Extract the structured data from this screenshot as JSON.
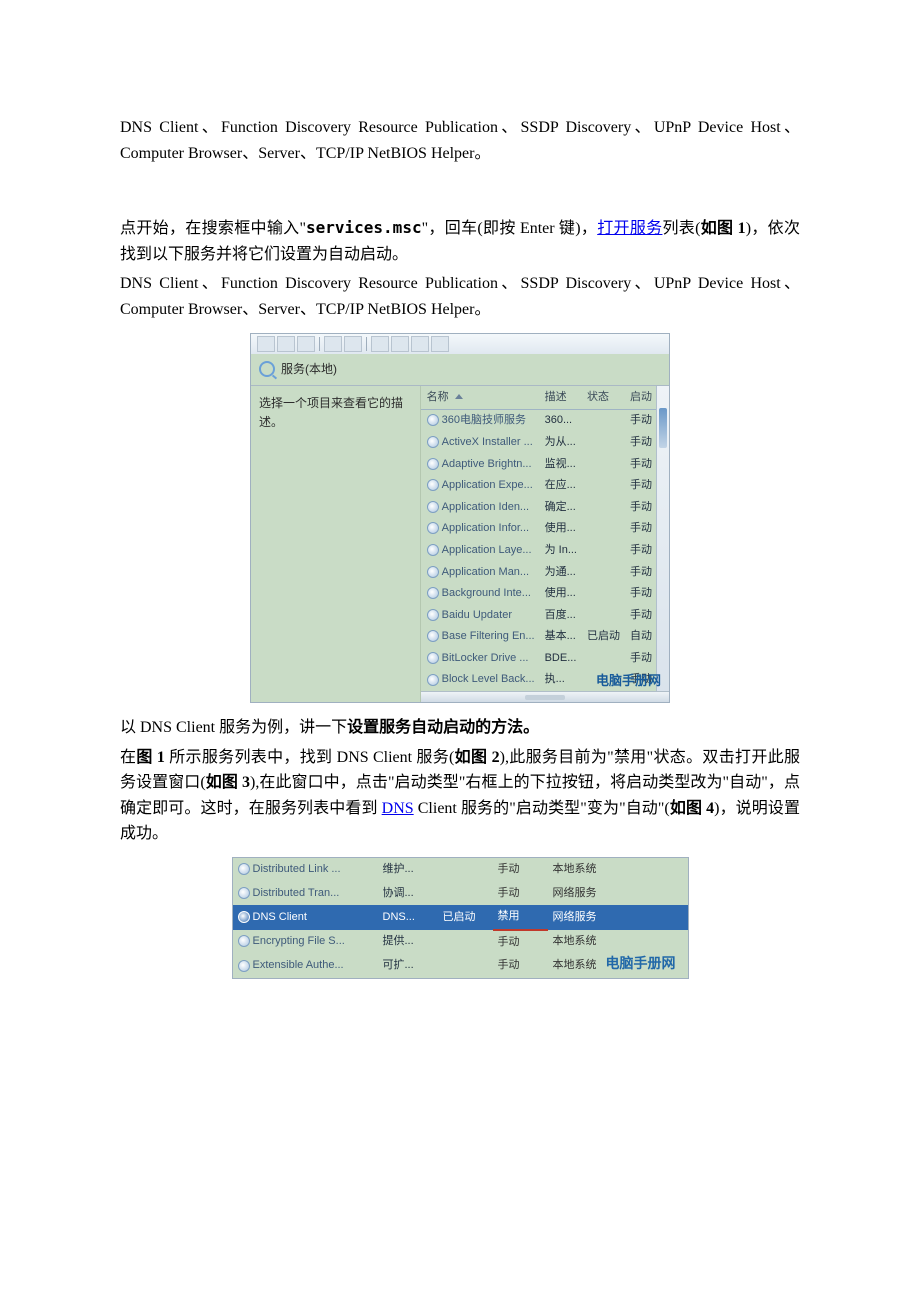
{
  "para1": "DNS Client、Function Discovery Resource Publication、SSDP Discovery、UPnP Device Host、Computer Browser、Server、TCP/IP NetBIOS Helper。",
  "para2a": "点开始，在搜索框中输入\"",
  "para2_cmd": "services.msc",
  "para2b": "\"，回车(即按 Enter 键)，",
  "para2_link": "打开服务",
  "para2c": "列表(",
  "para2_fig": "如图 1",
  "para2d": ")，依次找到以下服务并将它们设置为自动启动。",
  "para3": "DNS Client、Function Discovery Resource Publication、SSDP Discovery、UPnP Device Host、Computer Browser、Server、TCP/IP NetBIOS Helper。",
  "fig1": {
    "title": "服务(本地)",
    "left_hint": "选择一个项目来查看它的描述。",
    "columns": {
      "name": "名称",
      "desc": "描述",
      "state": "状态",
      "startup": "启动"
    },
    "rows": [
      {
        "name": "360电脑技师服务",
        "desc": "360...",
        "state": "",
        "startup": "手动"
      },
      {
        "name": "ActiveX Installer ...",
        "desc": "为从...",
        "state": "",
        "startup": "手动"
      },
      {
        "name": "Adaptive Brightn...",
        "desc": "监视...",
        "state": "",
        "startup": "手动"
      },
      {
        "name": "Application Expe...",
        "desc": "在应...",
        "state": "",
        "startup": "手动"
      },
      {
        "name": "Application Iden...",
        "desc": "确定...",
        "state": "",
        "startup": "手动"
      },
      {
        "name": "Application Infor...",
        "desc": "使用...",
        "state": "",
        "startup": "手动"
      },
      {
        "name": "Application Laye...",
        "desc": "为 In...",
        "state": "",
        "startup": "手动"
      },
      {
        "name": "Application Man...",
        "desc": "为通...",
        "state": "",
        "startup": "手动"
      },
      {
        "name": "Background Inte...",
        "desc": "使用...",
        "state": "",
        "startup": "手动"
      },
      {
        "name": "Baidu Updater",
        "desc": "百度...",
        "state": "",
        "startup": "手动"
      },
      {
        "name": "Base Filtering En...",
        "desc": "基本...",
        "state": "已启动",
        "startup": "自动"
      },
      {
        "name": "BitLocker Drive ...",
        "desc": "BDE...",
        "state": "",
        "startup": "手动"
      },
      {
        "name": "Block Level Back...",
        "desc": "执...",
        "state": "",
        "startup": "手动"
      }
    ],
    "watermark": "电脑手册网"
  },
  "para4a": "以 DNS Client 服务为例，讲一下",
  "para4_bold": "设置服务自动启动的方法。",
  "para5a": "在",
  "para5_fig1": "图 1",
  "para5b": " 所示服务列表中，找到 DNS Client 服务(",
  "para5_fig2": "如图 2",
  "para5c": "),此服务目前为\"禁用\"状态。双击打开此服务设置窗口(",
  "para5_fig3": "如图 3",
  "para5d": "),在此窗口中，点击\"启动类型\"右框上的下拉按钮，将启动类型改为\"自动\"，点确定即可。这时，在服务列表中看到 ",
  "para5_dns": "DNS",
  "para5e": " Client 服务的\"启动类型\"变为\"自动\"(",
  "para5_fig4": "如图 4",
  "para5f": ")，说明设置成功。",
  "fig2": {
    "rows": [
      {
        "name": "Distributed Link ...",
        "desc": "维护...",
        "state": "",
        "startup": "手动",
        "acct": "本地系统",
        "sel": false
      },
      {
        "name": "Distributed Tran...",
        "desc": "协调...",
        "state": "",
        "startup": "手动",
        "acct": "网络服务",
        "sel": false
      },
      {
        "name": "DNS Client",
        "desc": "DNS...",
        "state": "已启动",
        "startup": "禁用",
        "acct": "网络服务",
        "sel": true
      },
      {
        "name": "Encrypting File S...",
        "desc": "提供...",
        "state": "",
        "startup": "手动",
        "acct": "本地系统",
        "sel": false
      },
      {
        "name": "Extensible Authe...",
        "desc": "可扩...",
        "state": "",
        "startup": "手动",
        "acct": "本地系统",
        "sel": false
      }
    ],
    "watermark": "电脑手册网"
  }
}
